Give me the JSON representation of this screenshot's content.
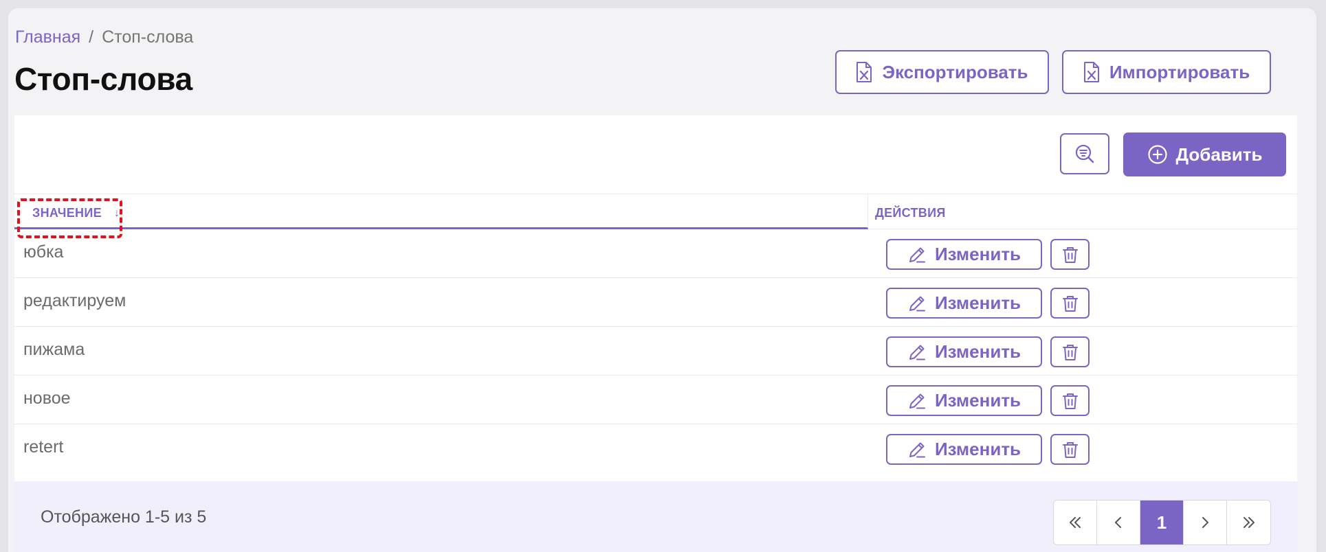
{
  "breadcrumb": {
    "home": "Главная",
    "separator": "/",
    "current": "Стоп-слова"
  },
  "page": {
    "title": "Стоп-слова"
  },
  "toolbar": {
    "export_label": "Экспортировать",
    "import_label": "Импортировать",
    "add_label": "Добавить"
  },
  "table": {
    "columns": {
      "value": "ЗНАЧЕНИЕ",
      "sort": "↓",
      "actions": "ДЕЙСТВИЯ"
    },
    "edit_label": "Изменить",
    "rows": [
      {
        "value": "юбка"
      },
      {
        "value": "редактируем"
      },
      {
        "value": "пижама"
      },
      {
        "value": "новое"
      },
      {
        "value": "retert"
      }
    ]
  },
  "footer": {
    "summary": "Отображено 1-5 из 5",
    "pages": [
      "1"
    ],
    "current_page": "1"
  },
  "colors": {
    "accent": "#7b64c4",
    "footer_bg": "#f1effc",
    "highlight": "#e3101e"
  },
  "icons": [
    "excel-file-icon",
    "search-filter-icon",
    "plus-circle-icon",
    "pencil-icon",
    "trash-icon",
    "double-chevron-left-icon",
    "chevron-left-icon",
    "chevron-right-icon",
    "double-chevron-right-icon"
  ]
}
